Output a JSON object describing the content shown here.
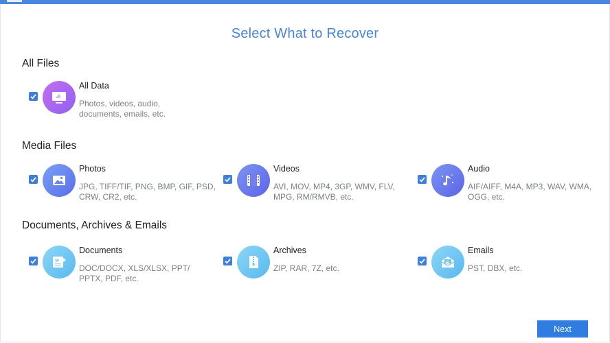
{
  "page": {
    "title": "Select What to Recover",
    "accent_color": "#4a86e0",
    "next_label": "Next"
  },
  "sections": [
    {
      "title": "All Files",
      "items": [
        {
          "label": "All Data",
          "desc": "Photos, videos, audio, documents, emails, etc.",
          "checked": true,
          "icon": "monitor-icon"
        }
      ]
    },
    {
      "title": "Media Files",
      "items": [
        {
          "label": "Photos",
          "desc": "JPG, TIFF/TIF, PNG, BMP, GIF, PSD, CRW, CR2, etc.",
          "checked": true,
          "icon": "photo-icon"
        },
        {
          "label": "Videos",
          "desc": "AVI, MOV, MP4, 3GP, WMV, FLV, MPG, RM/RMVB, etc.",
          "checked": true,
          "icon": "film-icon"
        },
        {
          "label": "Audio",
          "desc": "AIF/AIFF, M4A, MP3, WAV, WMA, OGG, etc.",
          "checked": true,
          "icon": "music-note-icon"
        }
      ]
    },
    {
      "title": "Documents, Archives & Emails",
      "items": [
        {
          "label": "Documents",
          "desc": "DOC/DOCX, XLS/XLSX, PPT/ PPTX, PDF, etc.",
          "checked": true,
          "icon": "word-document-icon"
        },
        {
          "label": "Archives",
          "desc": "ZIP, RAR, 7Z, etc.",
          "checked": true,
          "icon": "zip-file-icon"
        },
        {
          "label": "Emails",
          "desc": "PST, DBX, etc.",
          "checked": true,
          "icon": "envelope-icon"
        }
      ]
    }
  ]
}
